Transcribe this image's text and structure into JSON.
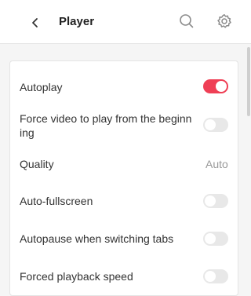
{
  "header": {
    "title": "Player",
    "icons": {
      "back": "chevron-left-icon",
      "search": "search-icon",
      "settings": "gear-icon"
    }
  },
  "colors": {
    "accent": "#ef3f55",
    "toggle_off": "#e8e8e8"
  },
  "settings": [
    {
      "label": "Autoplay",
      "type": "toggle",
      "state": "on"
    },
    {
      "label": "Force video to play from the beginning",
      "type": "toggle",
      "state": "off"
    },
    {
      "label": "Quality",
      "type": "value",
      "value": "Auto"
    },
    {
      "label": "Auto-fullscreen",
      "type": "toggle",
      "state": "off"
    },
    {
      "label": "Autopause when switching tabs",
      "type": "toggle",
      "state": "off"
    },
    {
      "label": "Forced playback speed",
      "type": "toggle",
      "state": "off"
    }
  ]
}
